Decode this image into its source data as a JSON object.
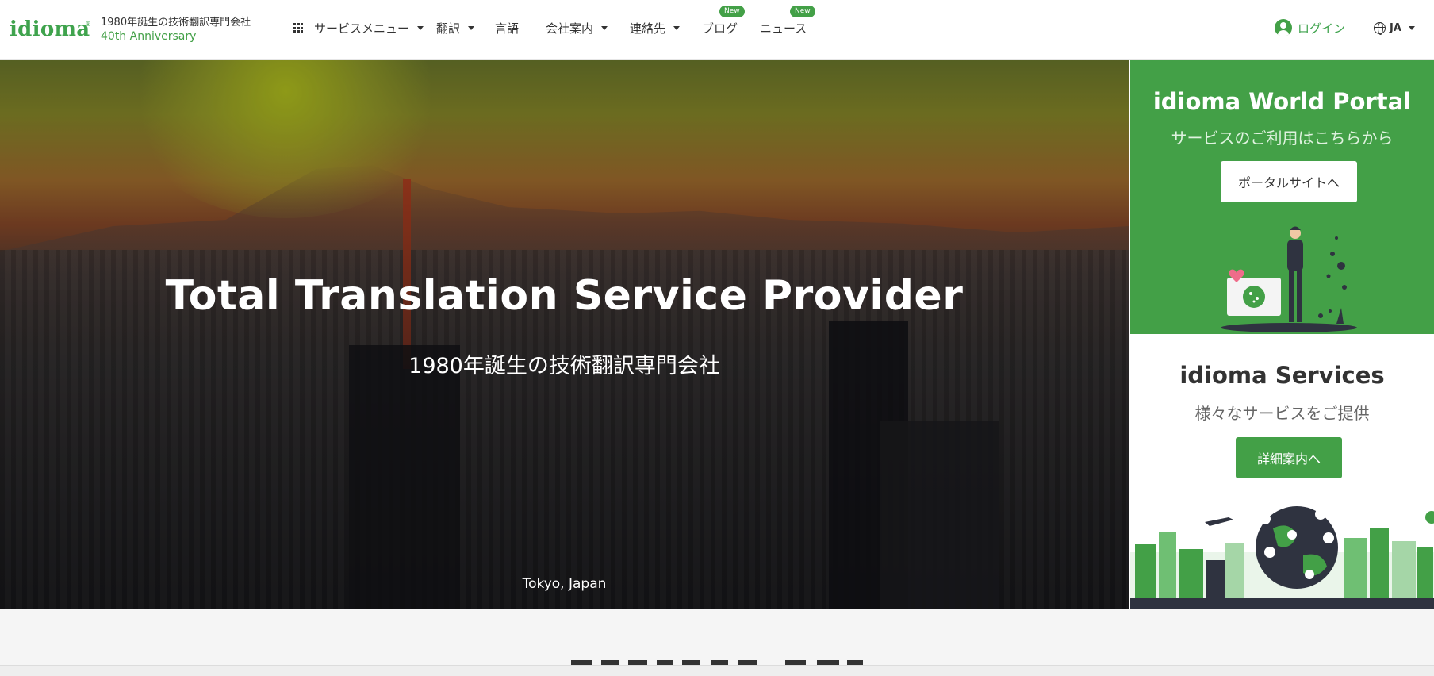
{
  "header": {
    "logo_text": "idioma",
    "logo_mark": "®",
    "tagline": "1980年誕生の技術翻訳専門会社",
    "anniversary": "40th Anniversary",
    "nav": [
      {
        "label": "サービスメニュー",
        "icon": "grid-icon",
        "dropdown": true
      },
      {
        "label": "翻訳",
        "dropdown": true
      },
      {
        "label": "言語",
        "dropdown": false
      },
      {
        "label": "会社案内",
        "dropdown": true
      },
      {
        "label": "連絡先",
        "dropdown": true
      },
      {
        "label": "ブログ",
        "badge": "New"
      },
      {
        "label": "ニュース",
        "badge": "New"
      }
    ],
    "login_label": "ログイン",
    "lang_label": "JA"
  },
  "hero": {
    "title": "Total Translation Service Provider",
    "subtitle": "1980年誕生の技術翻訳専門会社",
    "caption": "Tokyo, Japan"
  },
  "portal": {
    "title": "idioma World Portal",
    "subtitle": "サービスのご利用はこちらから",
    "button": "ポータルサイトへ"
  },
  "services": {
    "title": "idioma Services",
    "subtitle": "様々なサービスをご提供",
    "button": "詳細案内へ"
  },
  "colors": {
    "brand_green": "#43a047",
    "text_dark": "#333333"
  }
}
